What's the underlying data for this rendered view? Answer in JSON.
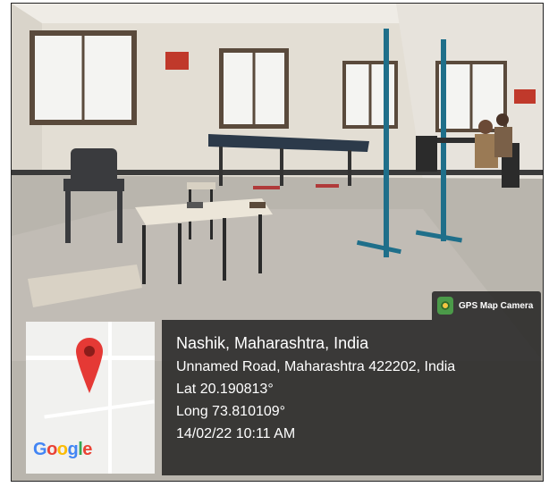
{
  "badge": {
    "label": "GPS Map Camera"
  },
  "map_logo": {
    "letters": [
      "G",
      "o",
      "o",
      "g",
      "l",
      "e"
    ],
    "colors": [
      "#4285F4",
      "#EA4335",
      "#FBBC05",
      "#4285F4",
      "#34A853",
      "#EA4335"
    ]
  },
  "location": {
    "city": "Nashik, Maharashtra, India",
    "address": "Unnamed Road, Maharashtra 422202, India",
    "lat": "Lat 20.190813°",
    "long": "Long 73.810109°",
    "datetime": "14/02/22 10:11 AM"
  },
  "colors": {
    "pin": "#e53935",
    "overlay": "#141414"
  }
}
